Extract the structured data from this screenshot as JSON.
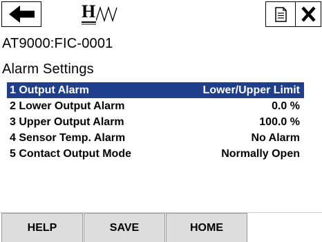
{
  "header": {
    "logo_letter": "H",
    "back_icon": "arrow-left-icon",
    "document_icon": "document-icon",
    "close_icon": "close-x-icon"
  },
  "device_path": "AT9000:FIC-0001",
  "section_title": "Alarm Settings",
  "menu": {
    "items": [
      {
        "label": "1 Output Alarm",
        "value": "Lower/Upper Limit",
        "selected": true
      },
      {
        "label": "2 Lower Output Alarm",
        "value": "0.0 %"
      },
      {
        "label": "3 Upper Output Alarm",
        "value": "100.0 %"
      },
      {
        "label": "4 Sensor Temp. Alarm",
        "value": "No Alarm"
      },
      {
        "label": "5 Contact Output Mode",
        "value": "Normally Open"
      }
    ]
  },
  "softkeys": {
    "help": "HELP",
    "save": "SAVE",
    "home": "HOME"
  },
  "colors": {
    "selection": "#1f3f8c",
    "softkey_bg": "#dddddd"
  }
}
